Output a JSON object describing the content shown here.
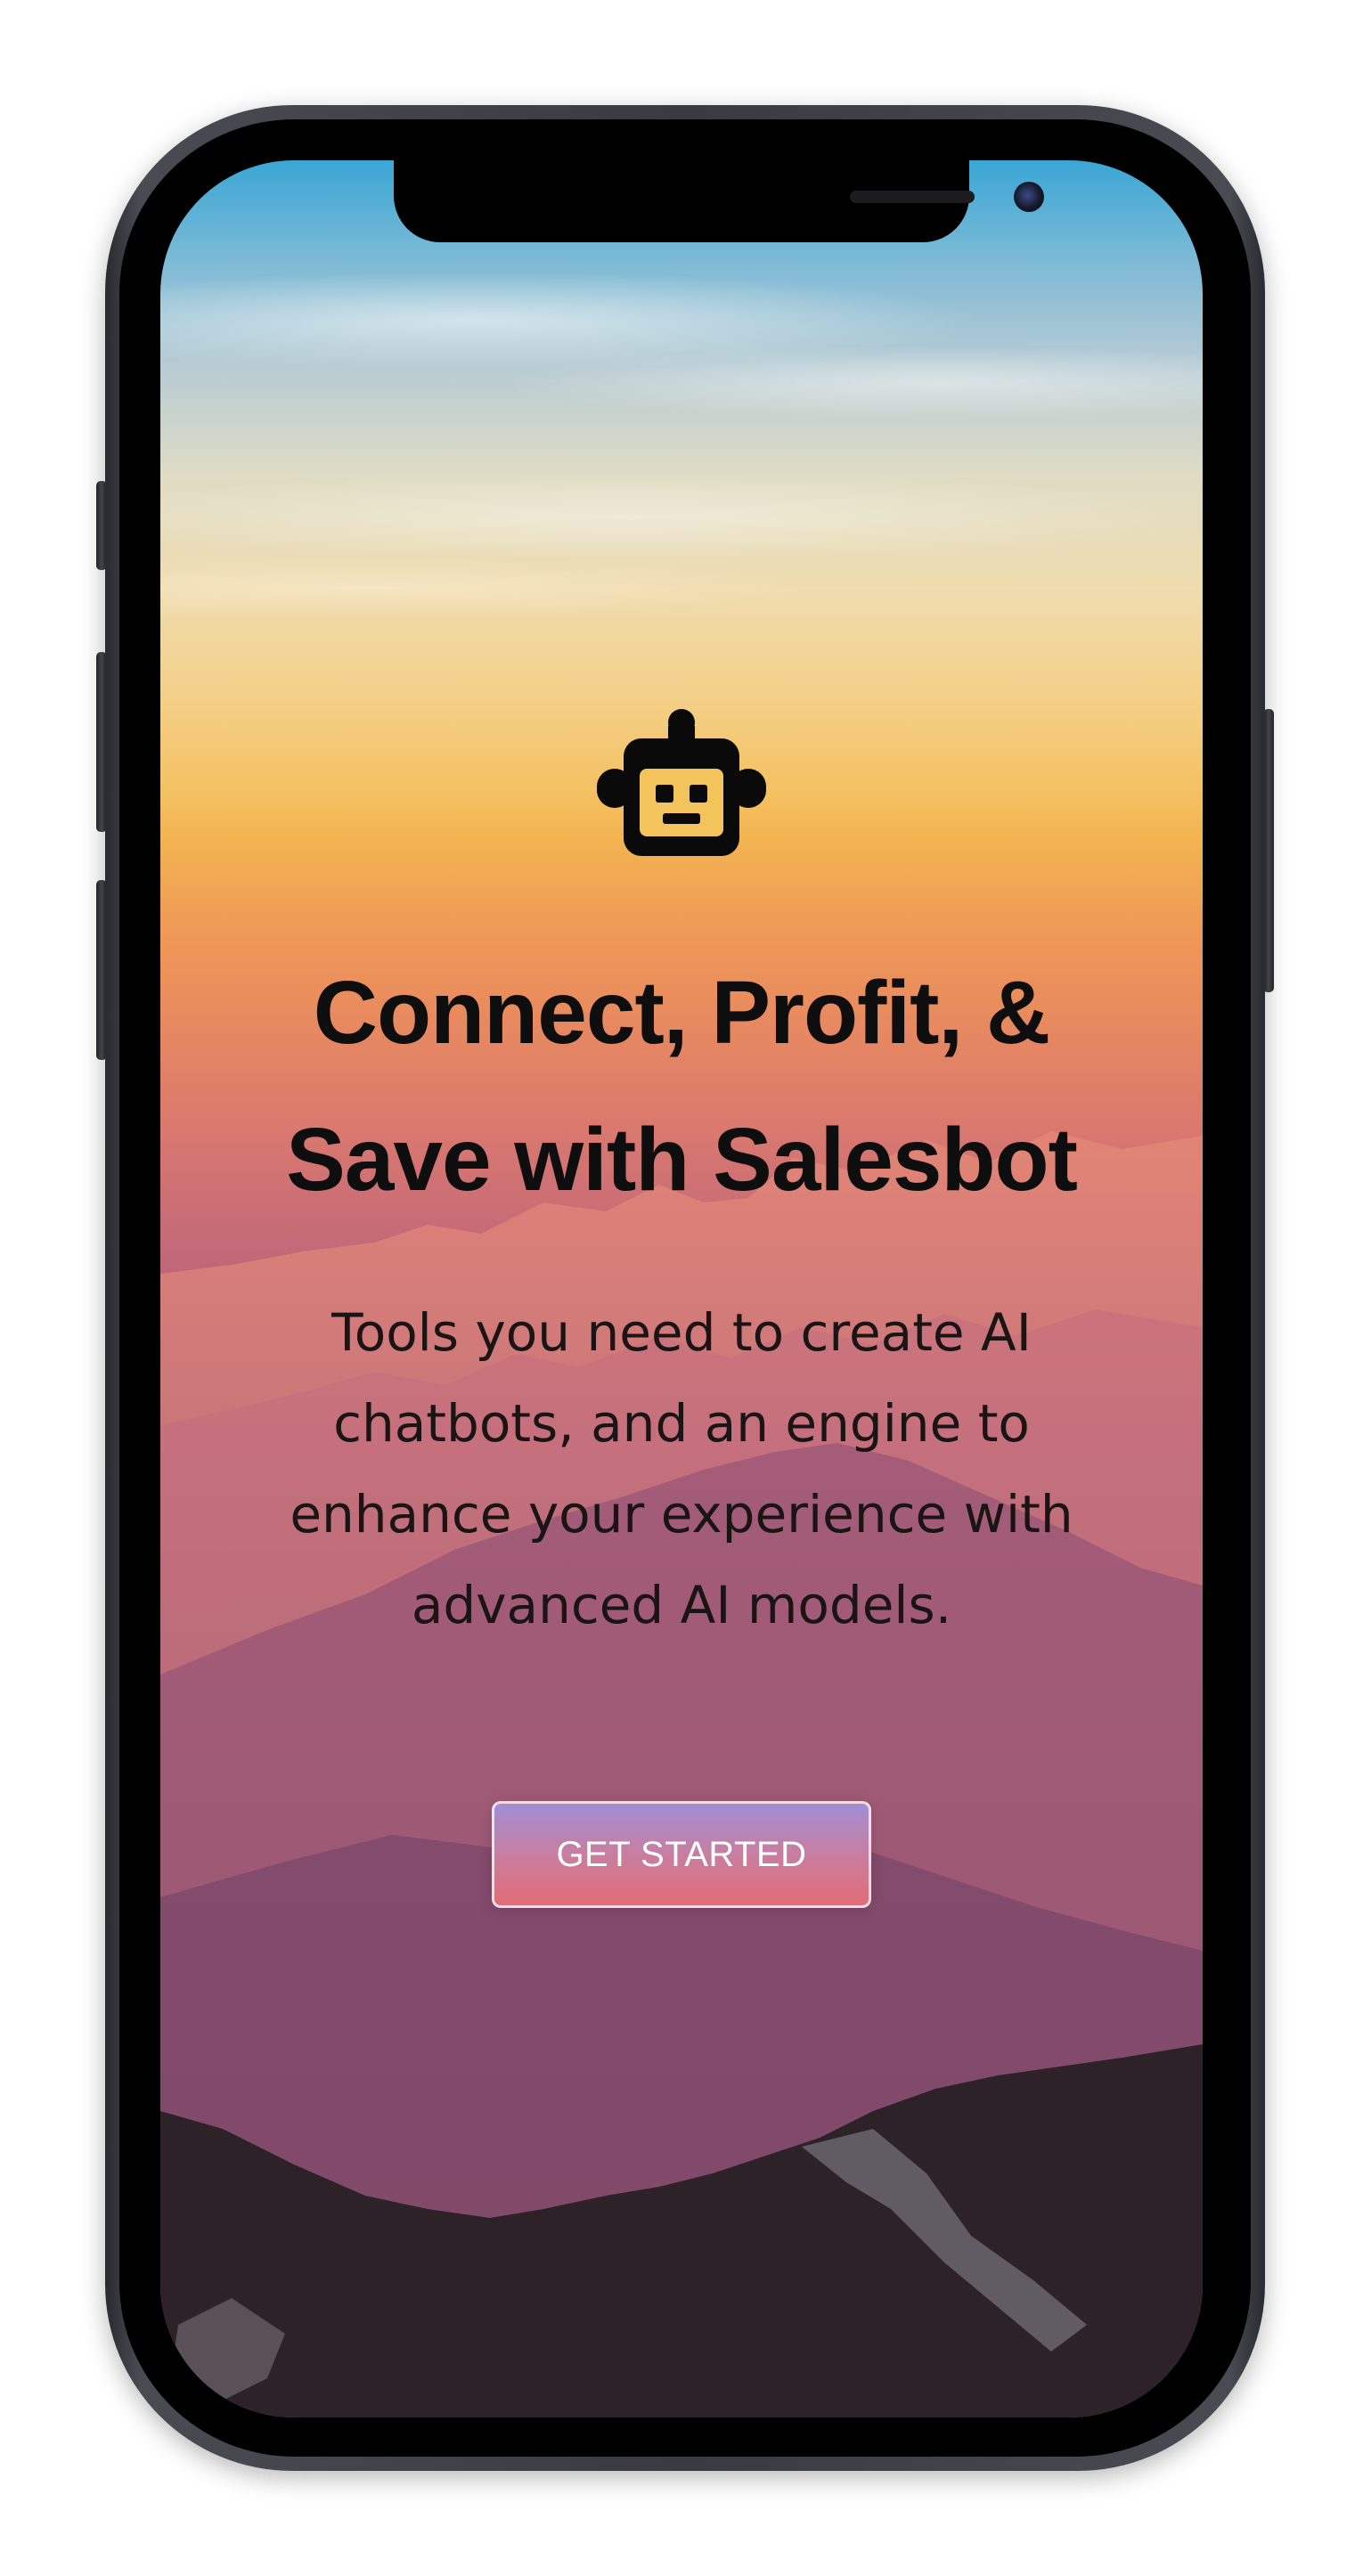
{
  "hero": {
    "icon": "robot-icon",
    "title": "Connect, Profit, & Save with Salesbot",
    "subtitle": "Tools you need to create AI chatbots, and an engine to enhance your experience with advanced AI models.",
    "cta_label": "GET STARTED"
  },
  "colors": {
    "title_text": "#0e0e0e",
    "cta_gradient_top": "#a08fd6",
    "cta_gradient_bottom": "#e26c76",
    "phone_frame": "#3a3a41"
  }
}
